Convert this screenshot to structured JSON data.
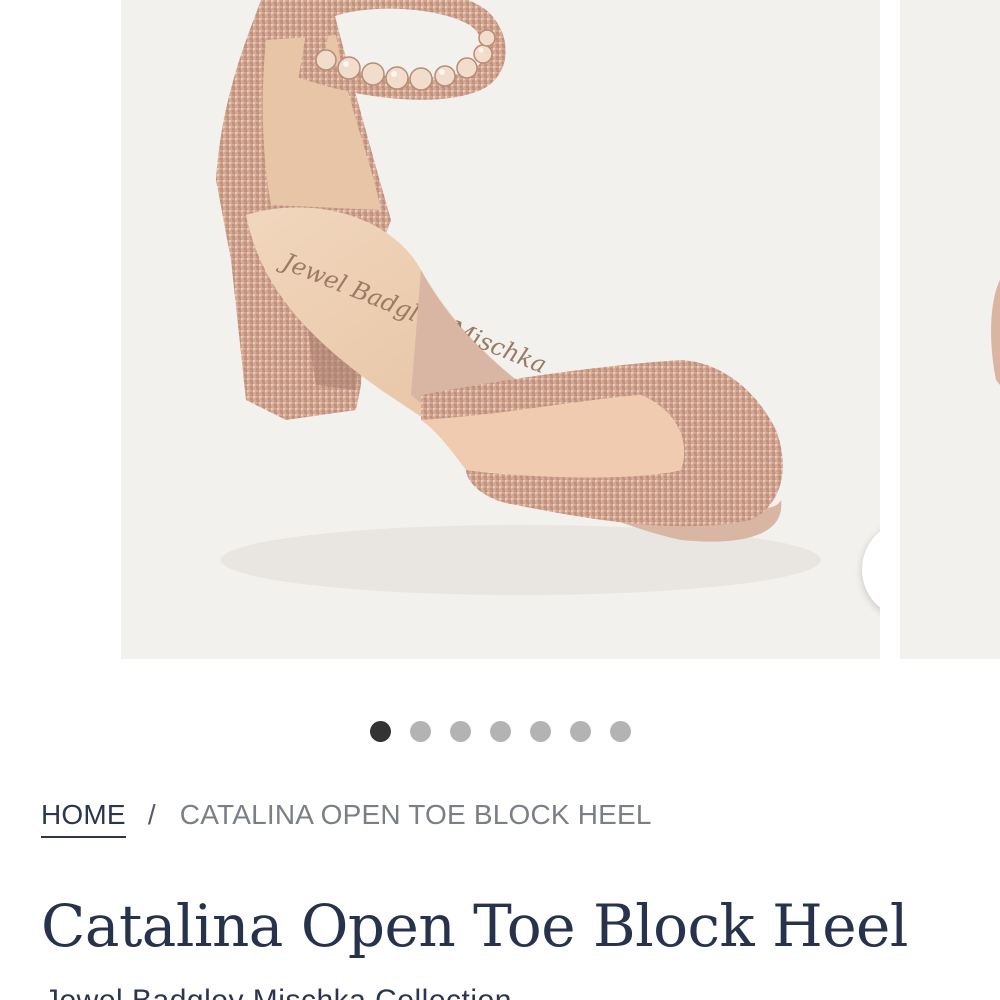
{
  "gallery": {
    "image_alt": "Catalina Open Toe Block Heel",
    "insole_logo_text": "Jewel Badgley Mischka",
    "zoom_icon": "search-icon",
    "dot_count": 7,
    "active_index": 0
  },
  "breadcrumb": {
    "home_label": "HOME",
    "separator": "/",
    "current_label": "CATALINA OPEN TOE BLOCK HEEL"
  },
  "product": {
    "title": "Catalina Open Toe Block Heel",
    "subtitle": "Jewel Badgley Mischka Collection"
  },
  "colors": {
    "brand_navy": "#27324c",
    "image_background": "#f3f1ee",
    "dot_active": "#333333",
    "dot_inactive": "#b3b3b3"
  }
}
